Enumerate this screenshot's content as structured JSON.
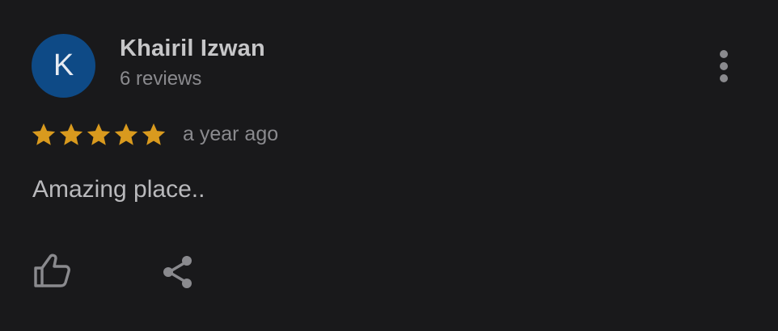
{
  "review": {
    "author_initial": "K",
    "author_name": "Khairil Izwan",
    "author_reviews": "6 reviews",
    "rating": 5,
    "rating_max": 5,
    "time_ago": "a year ago",
    "text": "Amazing place.."
  },
  "icons": {
    "more": "more-vert-icon",
    "like": "thumb-up-icon",
    "share": "share-icon",
    "star": "star-icon"
  },
  "colors": {
    "background": "#19191b",
    "avatar": "#0e4a86",
    "star": "#d99a1e",
    "icon": "#8a8a8e"
  }
}
